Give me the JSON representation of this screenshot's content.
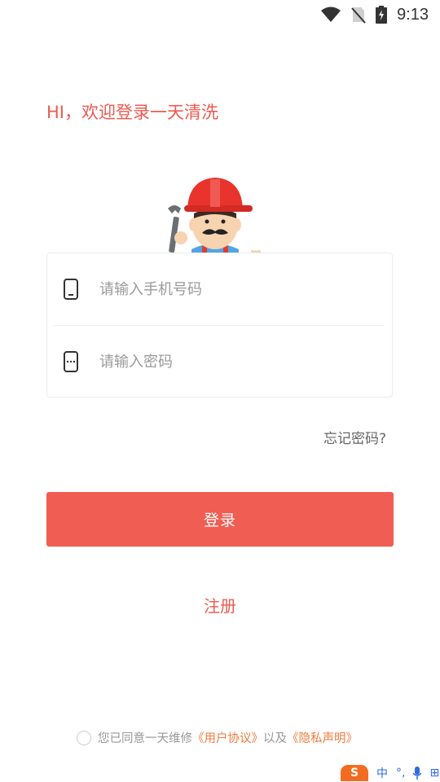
{
  "status_bar": {
    "time": "9:13"
  },
  "greeting": "HI，欢迎登录一天清洗",
  "form": {
    "phone_placeholder": "请输入手机号码",
    "password_placeholder": "请输入密码"
  },
  "forgot_password": "忘记密码?",
  "login_button": "登录",
  "register_link": "注册",
  "agreement": {
    "prefix": "您已同意一天维修",
    "user_agreement": "《用户协议》",
    "middle": "以及",
    "privacy": "《隐私声明》"
  },
  "ime": {
    "lang": "中",
    "dots": "°,",
    "extra": "⊞"
  },
  "colors": {
    "accent": "#ee5a50",
    "button": "#f05d52",
    "link": "#f07a3c"
  }
}
